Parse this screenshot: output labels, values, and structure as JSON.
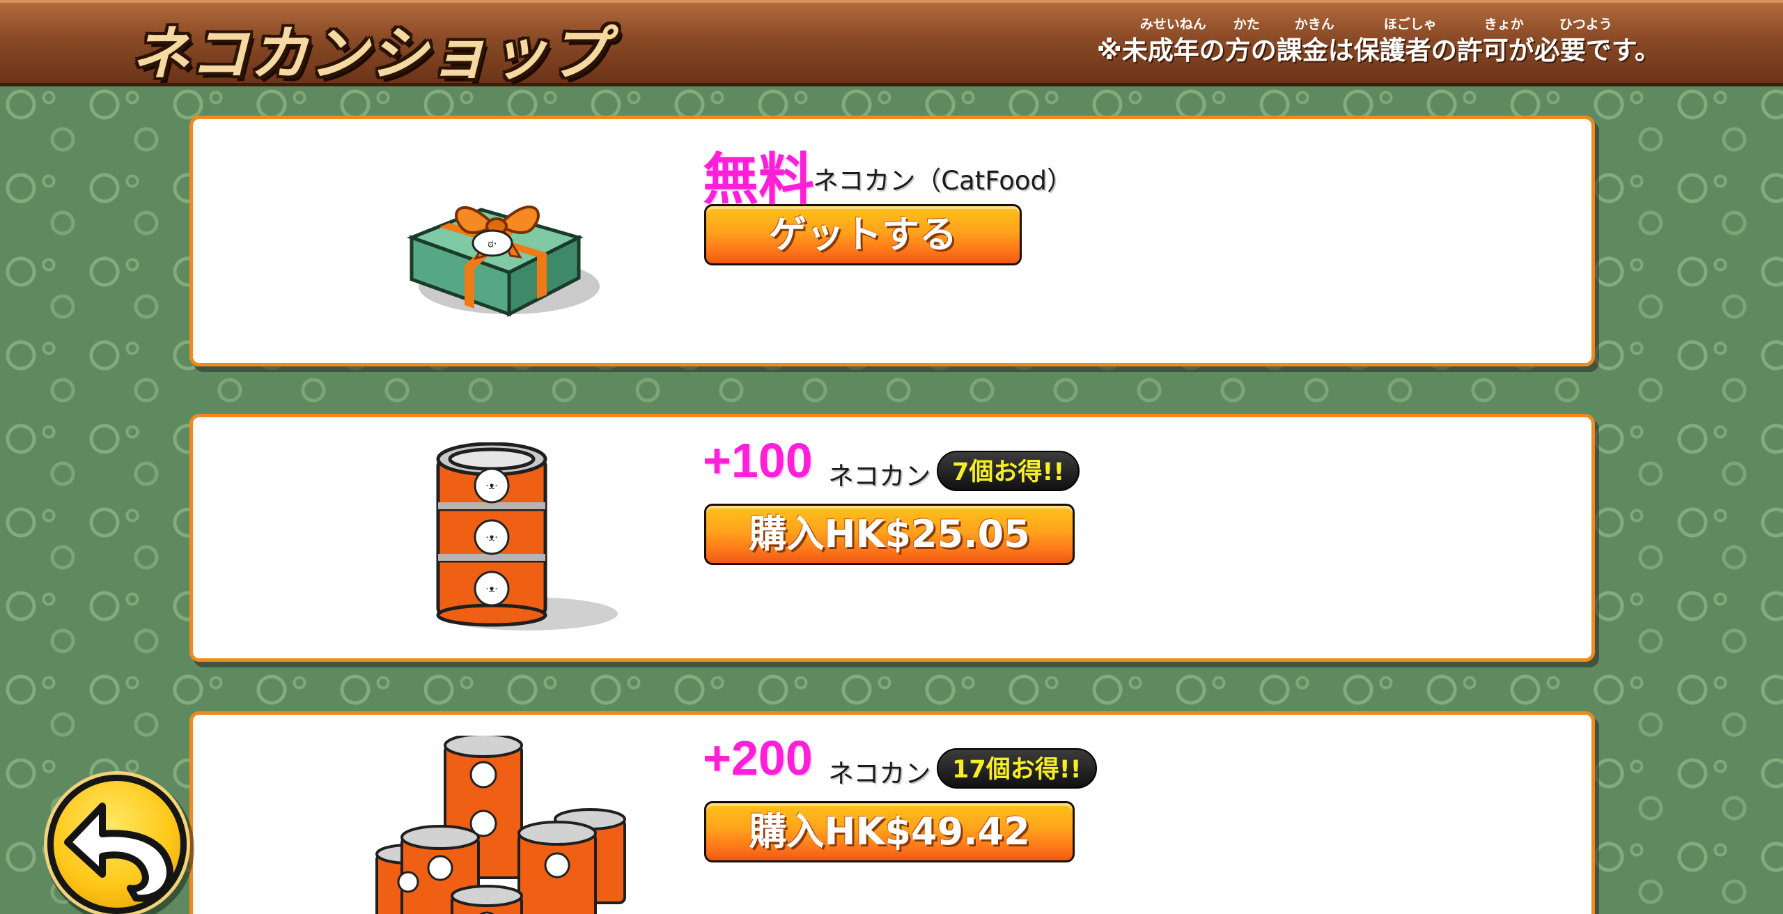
{
  "header": {
    "title": "ネコカンショップ",
    "notice": "※未成年の方の課金は保護者の許可が必要です。",
    "ruby": [
      "みせいねん",
      "かた",
      "かきん",
      "ほごしゃ",
      "きょか",
      "ひつよう"
    ]
  },
  "products": [
    {
      "amount": "無料",
      "name": "ネコカン（CatFood）",
      "bonus": "",
      "button": "ゲットする",
      "art": "gift-box-icon"
    },
    {
      "amount": "+100",
      "name": "ネコカン",
      "bonus": "7個お得!!",
      "button": "購入HK$25.05",
      "art": "cat-food-can-stack-icon"
    },
    {
      "amount": "+200",
      "name": "ネコカン",
      "bonus": "17個お得!!",
      "button": "購入HK$49.42",
      "art": "cat-food-can-pile-icon"
    }
  ],
  "colors": {
    "accent_pink": "#ff1fd8",
    "button_orange": "#ff8a1a",
    "card_border": "#f08a1c",
    "header_brown": "#8a4a26",
    "background_green": "#5f8a5f",
    "badge_yellow": "#f7ee2a"
  },
  "back_button": {
    "icon": "back-arrow-icon"
  }
}
